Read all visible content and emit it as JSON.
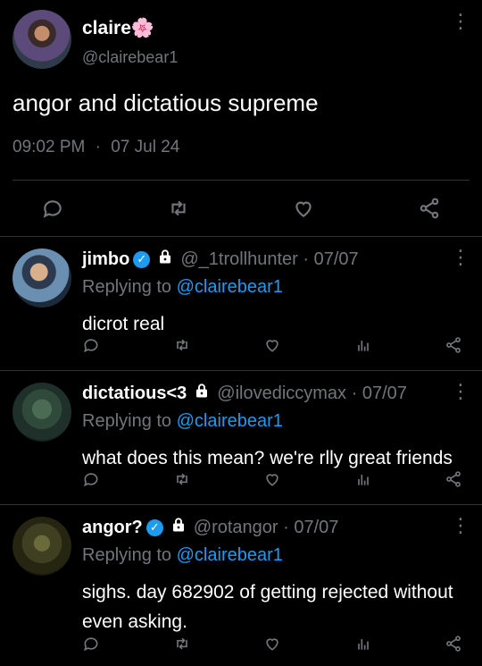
{
  "main_tweet": {
    "display_name": "claire🌸",
    "handle": "@clairebear1",
    "text": "angor and dictatious supreme",
    "time": "09:02 PM",
    "date": "07 Jul 24",
    "dot": "·",
    "more": "⋮"
  },
  "replies": [
    {
      "display_name": "jimbo",
      "verified": true,
      "locked": true,
      "handle_date": "@_1trollhunter · 07/07",
      "replying_prefix": "Replying to",
      "replying_handle": "@clairebear1",
      "text": "dicrot real",
      "more": "⋮"
    },
    {
      "display_name": "dictatious<3",
      "verified": false,
      "locked": true,
      "handle_date": "@ilovediccymax · 07/07",
      "replying_prefix": "Replying to",
      "replying_handle": "@clairebear1",
      "text": "what does this mean? we're rlly great friends",
      "more": "⋮"
    },
    {
      "display_name": "angor?",
      "verified": true,
      "locked": true,
      "handle_date": "@rotangor · 07/07",
      "replying_prefix": "Replying to",
      "replying_handle": "@clairebear1",
      "text": "sighs. day 682902 of getting rejected without even asking.",
      "more": "⋮"
    }
  ],
  "colors": {
    "background": "#000000",
    "text": "#e7e9ea",
    "muted": "#71767b",
    "link": "#1d9bf0",
    "divider": "#2f3336"
  },
  "icons": [
    "reply-icon",
    "retweet-icon",
    "like-icon",
    "analytics-icon",
    "share-icon",
    "lock-icon",
    "verified-icon",
    "more-icon"
  ]
}
